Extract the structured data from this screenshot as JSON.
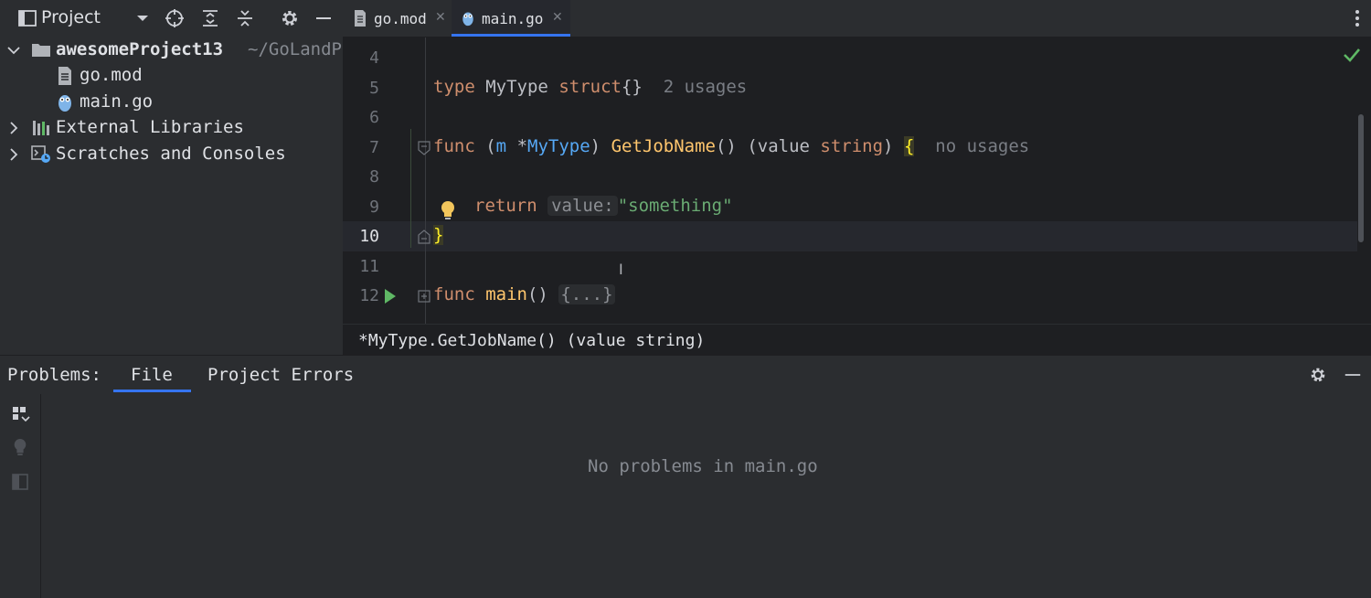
{
  "project_panel": {
    "title": "Project",
    "tree": [
      {
        "label": "awesomeProject13",
        "path_hint": "~/GoLandP",
        "expanded": true,
        "icon": "folder-icon"
      },
      {
        "label": "go.mod",
        "icon": "file-icon"
      },
      {
        "label": "main.go",
        "icon": "gopher-icon"
      },
      {
        "label": "External Libraries",
        "expanded": false,
        "icon": "library-icon"
      },
      {
        "label": "Scratches and Consoles",
        "expanded": false,
        "icon": "scratches-icon"
      }
    ]
  },
  "tabs": [
    {
      "label": "go.mod",
      "icon": "file-icon",
      "active": false
    },
    {
      "label": "main.go",
      "icon": "gopher-icon",
      "active": true
    }
  ],
  "editor": {
    "line_numbers": [
      "4",
      "5",
      "6",
      "7",
      "8",
      "9",
      "10",
      "11",
      "12"
    ],
    "lines": {
      "l5": {
        "kw": "type",
        "name": "MyType",
        "kw2": "struct",
        "braces": "{}",
        "hint": "2 usages"
      },
      "l7": {
        "kw": "func",
        "open": "(",
        "recv": "m",
        "ptr": "*",
        "recv_type": "MyType",
        "close": ")",
        "fname": "GetJobName",
        "parens": "()",
        "ret_open": "(value",
        "ret_type": "string",
        "ret_close": ")",
        "brace": "{",
        "hint": "no usages"
      },
      "l9": {
        "kw": "return",
        "param_hint": "value:",
        "value": "\"something\""
      },
      "l10": {
        "brace": "}"
      },
      "l12": {
        "kw": "func",
        "fname": "main",
        "parens": "()",
        "folded": "{...}"
      }
    }
  },
  "breadcrumb": "*MyType.GetJobName() (value string)",
  "problems": {
    "label": "Problems:",
    "tabs": [
      {
        "label": "File",
        "active": true
      },
      {
        "label": "Project Errors",
        "active": false
      }
    ],
    "empty_message": "No problems in main.go"
  },
  "colors": {
    "accent": "#3574f0",
    "keyword": "#cf8e6d",
    "function": "#ffc66d",
    "string": "#6aab73",
    "type": "#56a8f5",
    "ok_check": "#5fb865",
    "run_green": "#5fb865"
  }
}
